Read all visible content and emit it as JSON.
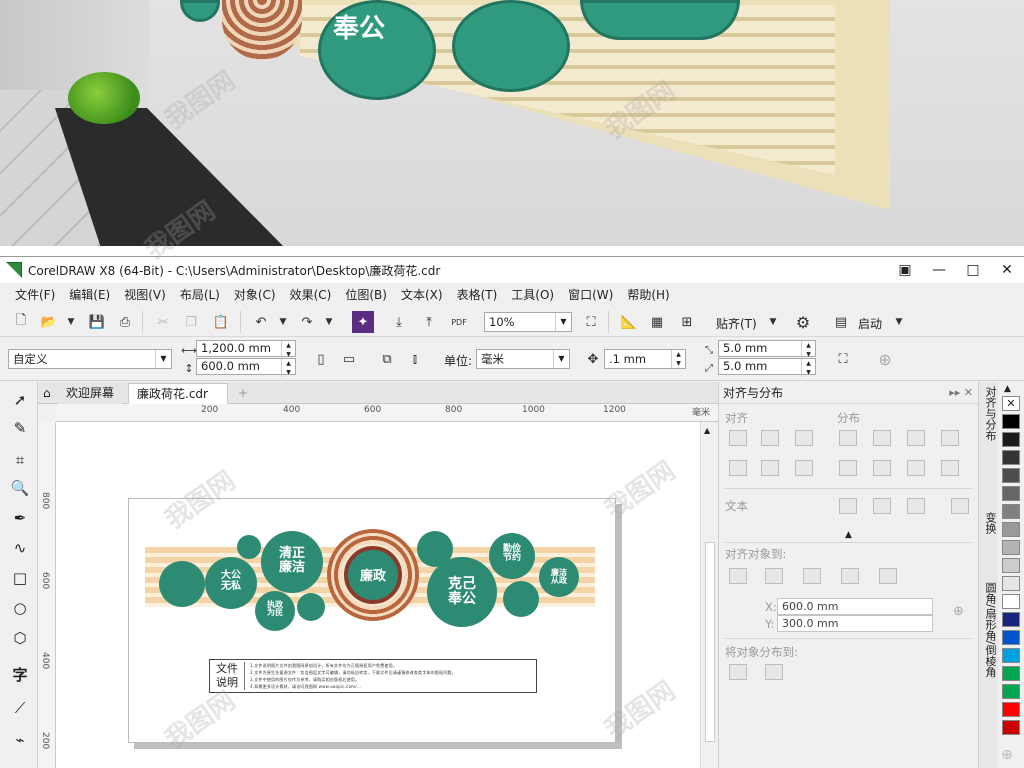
{
  "scene": {
    "leaf_text": "奉公"
  },
  "window": {
    "title": "CorelDRAW X8 (64-Bit) - C:\\Users\\Administrator\\Desktop\\廉政荷花.cdr",
    "buttons": [
      "□",
      "—",
      "□",
      "✕"
    ]
  },
  "menu": [
    "文件(F)",
    "编辑(E)",
    "视图(V)",
    "布局(L)",
    "对象(C)",
    "效果(C)",
    "位图(B)",
    "文本(X)",
    "表格(T)",
    "工具(O)",
    "窗口(W)",
    "帮助(H)"
  ],
  "toolbar": {
    "zoom_value": "10%",
    "snap_label": "贴齐(T)",
    "launch_label": "启动",
    "pdf_label": "PDF"
  },
  "propbar": {
    "page_preset": "自定义",
    "width": "1,200.0 mm",
    "height": "600.0 mm",
    "units_label": "单位:",
    "units_value": "毫米",
    "nudge": ".1 mm",
    "dup_x": "5.0 mm",
    "dup_y": "5.0 mm"
  },
  "tabs": {
    "welcome": "欢迎屏幕",
    "document": "廉政荷花.cdr"
  },
  "ruler": {
    "h_ticks": [
      "200",
      "400",
      "600",
      "800",
      "1000",
      "1200"
    ],
    "h_unit": "毫米",
    "v_ticks": [
      "800",
      "600",
      "400",
      "200"
    ]
  },
  "design": {
    "center": "廉政",
    "pads": [
      "大公\n无私",
      "清正\n廉洁",
      "执政\n为民",
      "克己\n奉公",
      "勤俭\n节约",
      "廉洁\n从政"
    ]
  },
  "note": {
    "title": "文件\n说明",
    "lines": [
      "1.文件说明图片文件由我图网原创设计，所有文件均为正版授权用户免费使用。",
      "2.文件为原生矢量源文件：包含图层文字可编辑，请勿私自转卖，下载文件后请谨慎修改各类字体的版权问题。",
      "3.文件中使用的图片仅作为参考，请购买相应版权后使用。",
      "4.如需更多设计素材，请访问我图网 www.ooopic.com/..."
    ]
  },
  "docker": {
    "title": "对齐与分布",
    "align_label": "对齐",
    "distribute_label": "分布",
    "text_label": "文本",
    "align_to_label": "对齐对象到:",
    "x_value": "600.0 mm",
    "y_value": "300.0 mm",
    "x_label": "X:",
    "y_label": "Y:",
    "distribute_to_label": "将对象分布到:"
  },
  "vtabs": [
    "对齐与分布",
    "变换",
    "圆角/扇形角/倒棱角"
  ],
  "palette": [
    "#ffffff",
    "#000000",
    "#1a1a1a",
    "#333333",
    "#4d4d4d",
    "#666666",
    "#808080",
    "#999999",
    "#b3b3b3",
    "#cccccc",
    "#e6e6e6",
    "#ffffff",
    "#1a237e",
    "#0055cc",
    "#00a0e0",
    "#00a651",
    "#00a651",
    "#ff0000",
    "#cc0000"
  ],
  "watermark": "我图网"
}
